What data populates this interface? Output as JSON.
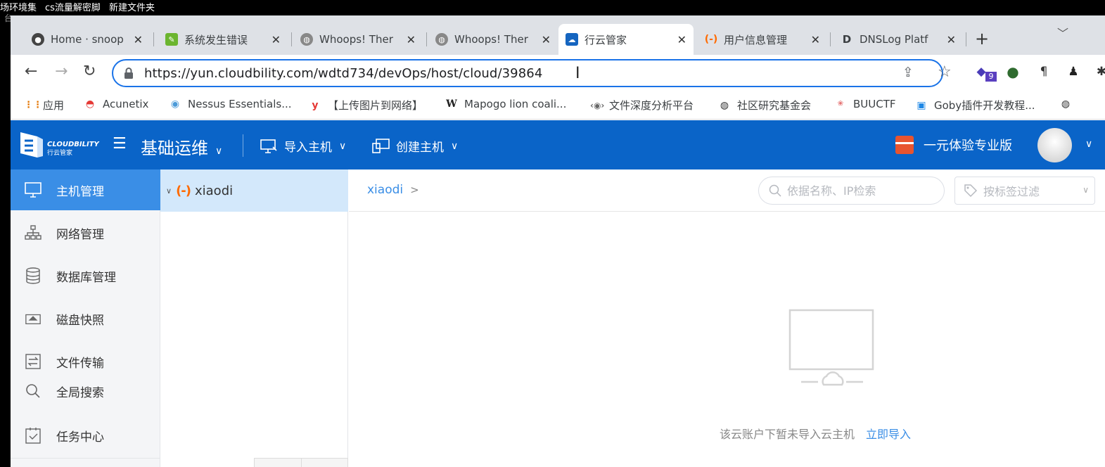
{
  "desktop": {
    "items": [
      "场环境集",
      "cs流量解密脚",
      "新建文件夹"
    ],
    "faded": "台"
  },
  "browser": {
    "tabs": [
      {
        "title": "Home · snoop",
        "icon": "github-icon"
      },
      {
        "title": "系统发生错误",
        "icon": "leaf-icon"
      },
      {
        "title": "Whoops! Ther",
        "icon": "globe-icon"
      },
      {
        "title": "Whoops! Ther",
        "icon": "globe-icon"
      },
      {
        "title": "行云管家",
        "icon": "cloudbility-icon",
        "active": true
      },
      {
        "title": "用户信息管理",
        "icon": "aliyun-icon"
      },
      {
        "title": "DNSLog Platf",
        "icon": "dnslog-icon"
      }
    ],
    "new_tab": "+",
    "url": "https://yun.cloudbility.com/wdtd734/devOps/host/cloud/39864",
    "extension_badge": "9",
    "bookmarks": [
      "应用",
      "Acunetix",
      "Nessus Essentials...",
      "【上传图片到网络】",
      "Mapogo lion coali...",
      "文件深度分析平台",
      "社区研究基金会",
      "BUUCTF",
      "Goby插件开发教程..."
    ],
    "bookmark_icons": {
      "wiki": "W",
      "yahoo": "y"
    }
  },
  "app": {
    "logo_text": "CLOUDBILITY",
    "logo_sub": "行云管家",
    "module": "基础运维",
    "import_host": "导入主机",
    "create_host": "创建主机",
    "trial": "一元体验专业版",
    "sidebar": [
      {
        "label": "主机管理",
        "icon": "monitor-icon",
        "active": true
      },
      {
        "label": "网络管理",
        "icon": "network-icon"
      },
      {
        "label": "数据库管理",
        "icon": "database-icon"
      },
      {
        "label": "磁盘快照",
        "icon": "disk-icon"
      },
      {
        "label": "文件传输",
        "icon": "file-transfer-icon"
      },
      {
        "label": "全局搜索",
        "icon": "search-icon"
      },
      {
        "label": "任务中心",
        "icon": "task-icon"
      }
    ],
    "tree_node": "xiaodi",
    "tree_icon_text": "(-)",
    "breadcrumb": "xiaodi",
    "breadcrumb_sep": ">",
    "search_placeholder": "依据名称、IP检索",
    "tag_filter_placeholder": "按标签过滤",
    "empty_message": "该云账户下暂未导入云主机",
    "empty_link": "立即导入"
  },
  "colors": {
    "app_nav": "#0a64c8",
    "sidebar_active": "#3a8ee6",
    "tree_selected": "#d3e8fb",
    "link": "#3a8ee6",
    "aliyun_orange": "#ff6a00"
  }
}
